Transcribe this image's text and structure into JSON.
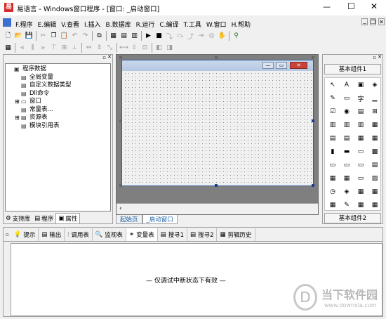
{
  "window": {
    "title": "易语言 - Windows窗口程序 - [窗口: _启动窗口]",
    "controls": {
      "min": "—",
      "max": "☐",
      "close": "✕"
    }
  },
  "menu": {
    "items": [
      "F.程序",
      "E.编辑",
      "V.查看",
      "I.插入",
      "B.数据库",
      "R.运行",
      "C.编译",
      "T.工具",
      "W.窗口",
      "H.帮助"
    ],
    "mdi": [
      "_",
      "❐",
      "✕"
    ]
  },
  "left_panel": {
    "tree": [
      {
        "label": "程序数据",
        "indent": 0,
        "expander": "",
        "icon": "▣"
      },
      {
        "label": "全局变量",
        "indent": 1,
        "expander": "",
        "icon": "▤"
      },
      {
        "label": "自定义数据类型",
        "indent": 1,
        "expander": "",
        "icon": "▤"
      },
      {
        "label": "Dll命令",
        "indent": 1,
        "expander": "",
        "icon": "▤"
      },
      {
        "label": "窗口",
        "indent": 1,
        "expander": "⊞",
        "icon": "▭"
      },
      {
        "label": "常量表...",
        "indent": 1,
        "expander": "",
        "icon": "▤"
      },
      {
        "label": "资源表",
        "indent": 1,
        "expander": "⊞",
        "icon": "▤"
      },
      {
        "label": "模块引用表",
        "indent": 1,
        "expander": "",
        "icon": "▤"
      }
    ],
    "tabs": [
      "支持库",
      "程序",
      "属性"
    ]
  },
  "designer": {
    "tabs": [
      "起始页",
      "_启动窗口"
    ],
    "form_buttons": [
      "—",
      "▭",
      "✕"
    ]
  },
  "right_panel": {
    "header": "基本组件1",
    "footer": "基本组件2",
    "components": [
      "↖",
      "A",
      "▣",
      "◈",
      "✎",
      "▭",
      "字",
      "▁",
      "☑",
      "◉",
      "▤",
      "⊞",
      "▥",
      "▥",
      "▥",
      "▦",
      "▤",
      "▤",
      "▦",
      "▦",
      "▮",
      "▬",
      "▭",
      "▩",
      "▭",
      "▭",
      "▭",
      "▤",
      "▦",
      "▦",
      "▭",
      "▨",
      "◷",
      "◈",
      "▦",
      "▦",
      "▦",
      "✎",
      "▦",
      "▦"
    ]
  },
  "bottom_panel": {
    "tabs": [
      "提示",
      "输出",
      "调用表",
      "监视表",
      "变量表",
      "搜寻1",
      "搜寻2",
      "剪辑历史"
    ],
    "message": "— 仅调试中断状态下有效 —"
  },
  "watermark": {
    "brand": "当下软件园",
    "url": "www.downxia.com"
  }
}
